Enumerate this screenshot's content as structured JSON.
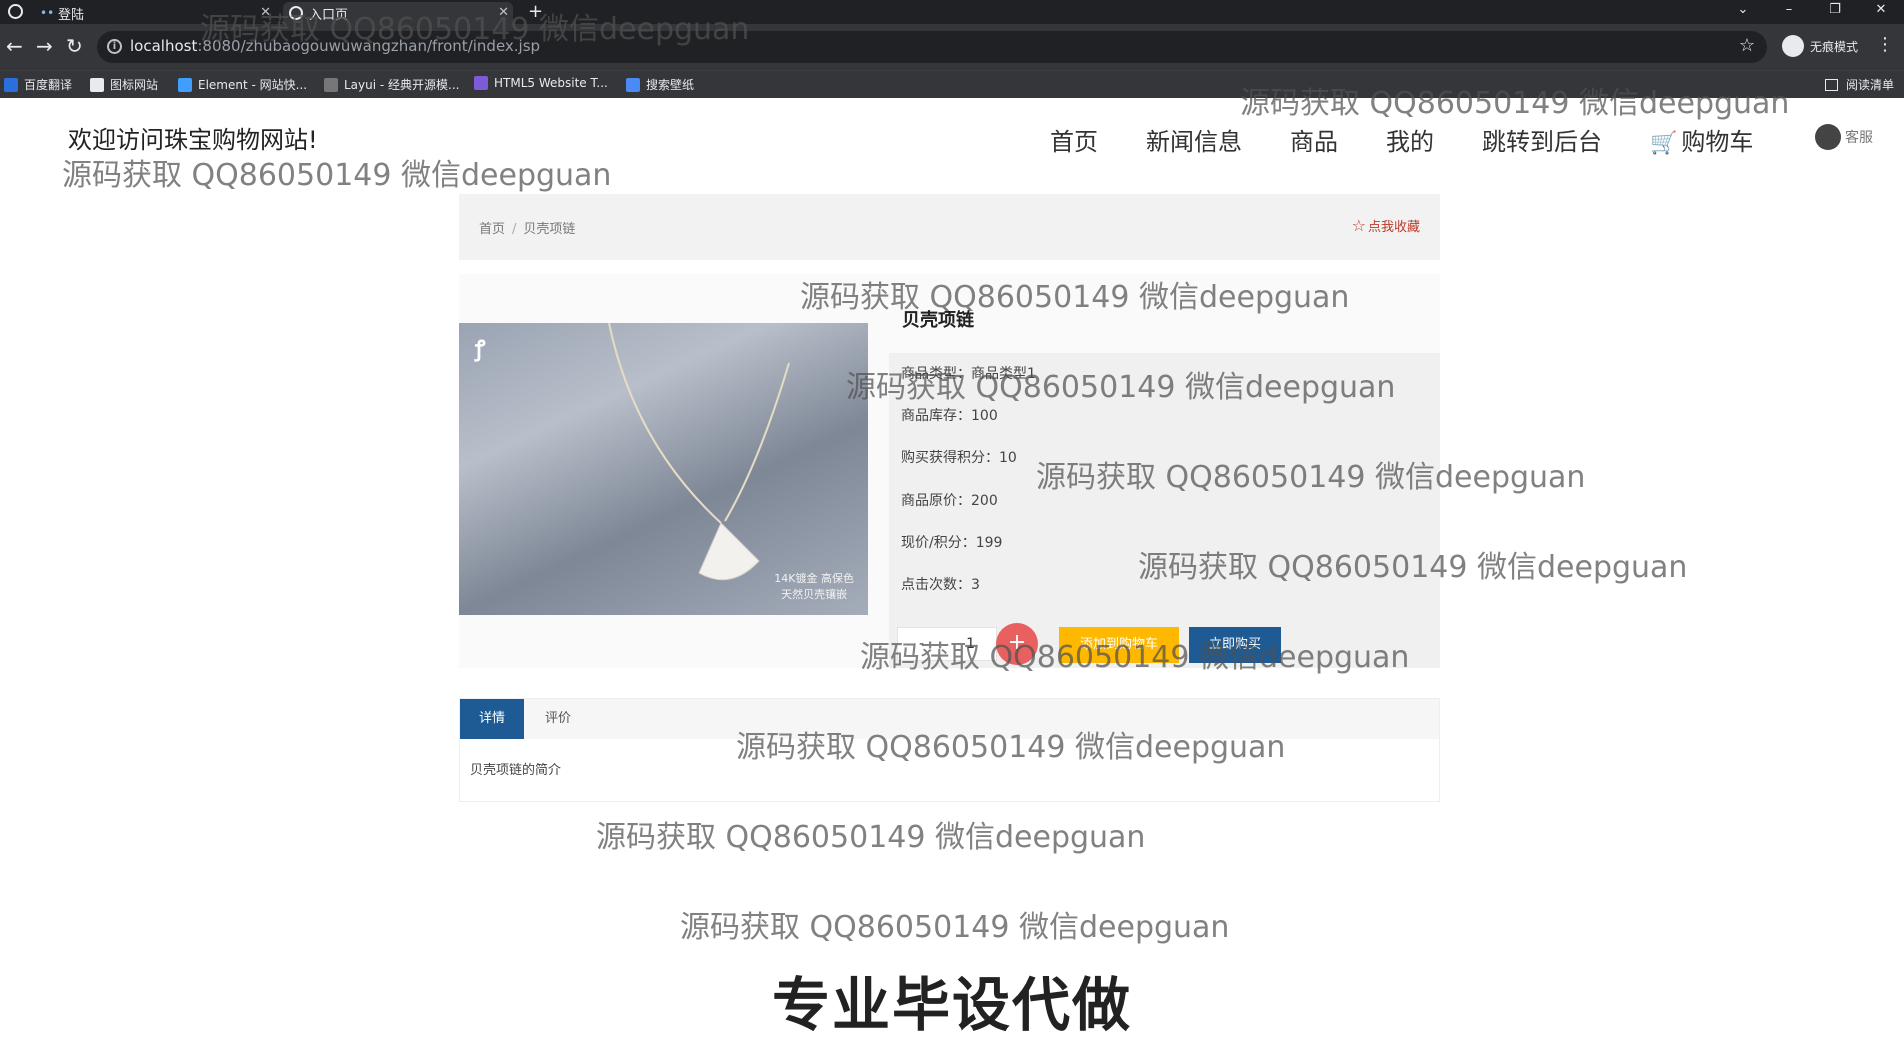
{
  "browser": {
    "tabs": [
      {
        "title": "登陆"
      },
      {
        "title": "入口页"
      }
    ],
    "url_host": "localhost",
    "url_rest": ":8080/zhubaogouwuwangzhan/front/index.jsp",
    "incognito_label": "无痕模式",
    "bookmarks": [
      "百度翻译",
      "图标网站",
      "Element - 网站快...",
      "Layui - 经典开源模...",
      "HTML5 Website T...",
      "搜索壁纸"
    ],
    "reading_list": "阅读清单"
  },
  "site": {
    "welcome": "欢迎访问珠宝购物网站!",
    "nav": [
      "首页",
      "新闻信息",
      "商品",
      "我的",
      "跳转到后台",
      "购物车"
    ],
    "service": "客服"
  },
  "breadcrumb": {
    "home": "首页",
    "separator": "/",
    "current": "贝壳项链",
    "collect": "点我收藏"
  },
  "product": {
    "name": "贝壳项链",
    "image_caption_1": "14K镀金 高保色",
    "image_caption_2": "天然贝壳镶嵌",
    "type_label": "商品类型：商品类型1",
    "stock_label": "商品库存：",
    "stock": "100",
    "points_label": "购买获得积分：",
    "points": "10",
    "original_price_label": "商品原价：",
    "original_price": "200",
    "current_price_label": "现价/积分：",
    "current_price": "199",
    "clicks_label": "点击次数：",
    "clicks": "3",
    "quantity": "1",
    "minus": "-",
    "plus": "+",
    "add_to_cart": "添加到购物车",
    "buy_now": "立即购买"
  },
  "detail": {
    "tab_details": "详情",
    "tab_comments": "评价",
    "intro": "贝壳项链的简介"
  },
  "watermark": "源码获取 QQ86050149 微信deepguan",
  "footer_slogan": "专业毕设代做"
}
